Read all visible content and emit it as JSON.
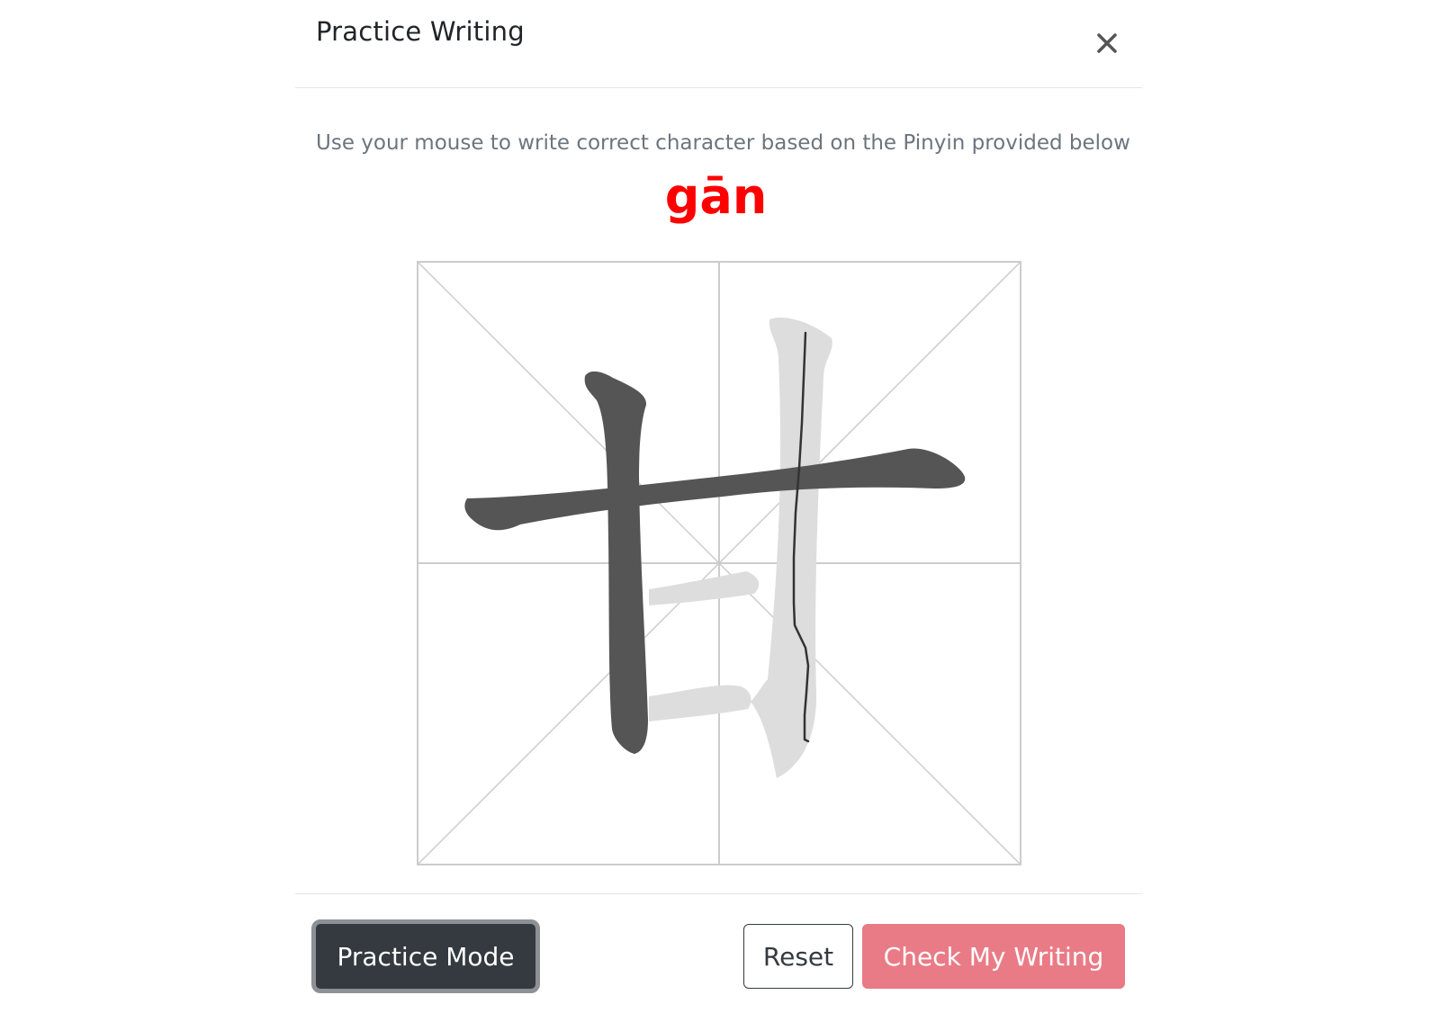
{
  "modal": {
    "title": "Practice Writing",
    "close_icon": "close-icon"
  },
  "instruction": "Use your mouse to write correct character based on the Pinyin provided below",
  "pinyin": "gān",
  "canvas": {
    "character": "甘",
    "completed_strokes": 2,
    "total_strokes": 5
  },
  "footer": {
    "practice_mode_label": "Practice Mode",
    "reset_label": "Reset",
    "check_label": "Check My Writing"
  },
  "colors": {
    "pinyin": "#ff0000",
    "practice_button_bg": "#343a40",
    "check_button_bg": "#e97b86",
    "stroke_done": "#555555",
    "stroke_outline": "#dddddd",
    "user_line": "#333333"
  }
}
